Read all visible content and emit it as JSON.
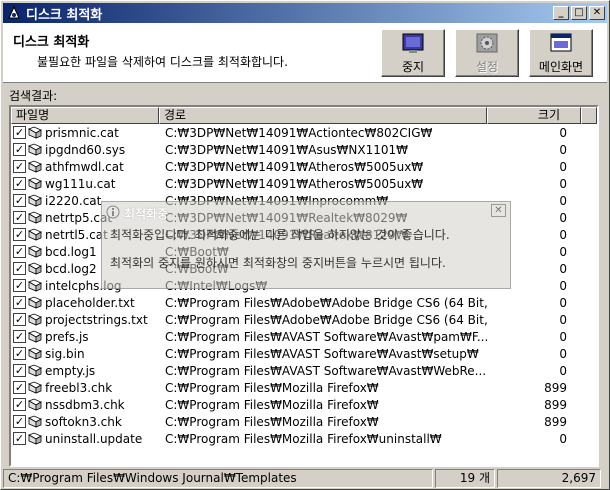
{
  "window": {
    "title": "디스크 최적화"
  },
  "header": {
    "title": "디스크 최적화",
    "description": "불필요한 파일을 삭제하여 디스크를 최적화합니다.",
    "buttons": {
      "stop": "중지",
      "settings": "설정",
      "main": "메인화면"
    }
  },
  "results": {
    "label": "검색결과:",
    "columns": {
      "name": "파일명",
      "path": "경로",
      "size": "크기"
    },
    "rows": [
      {
        "name": "prismnic.cat",
        "path": "C:₩3DP₩Net₩14091₩Actiontec₩802CIG₩",
        "size": "0"
      },
      {
        "name": "ipgdnd60.sys",
        "path": "C:₩3DP₩Net₩14091₩Asus₩NX1101₩",
        "size": "0"
      },
      {
        "name": "athfmwdl.cat",
        "path": "C:₩3DP₩Net₩14091₩Atheros₩5005ux₩",
        "size": "0"
      },
      {
        "name": "wg111u.cat",
        "path": "C:₩3DP₩Net₩14091₩Atheros₩5005ux₩",
        "size": "0"
      },
      {
        "name": "i2220.cat",
        "path": "C:₩3DP₩Net₩14091₩Inprocomm₩",
        "size": "0"
      },
      {
        "name": "netrtp5.cat",
        "path": "C:₩3DP₩Net₩14091₩Realtek₩8029₩",
        "size": "0"
      },
      {
        "name": "netrtl5.cat",
        "path": "C:₩3DP₩Net₩14091₩Realtek₩8129₩",
        "size": "0"
      },
      {
        "name": "bcd.log1",
        "path": "C:₩Boot₩",
        "size": "0"
      },
      {
        "name": "bcd.log2",
        "path": "C:₩Boot₩",
        "size": "0"
      },
      {
        "name": "intelcphs.log",
        "path": "C:₩Intel₩Logs₩",
        "size": "0"
      },
      {
        "name": "placeholder.txt",
        "path": "C:₩Program Files₩Adobe₩Adobe Bridge CS6 (64 Bit,...",
        "size": "0"
      },
      {
        "name": "projectstrings.txt",
        "path": "C:₩Program Files₩Adobe₩Adobe Bridge CS6 (64 Bit,...",
        "size": "0"
      },
      {
        "name": "prefs.js",
        "path": "C:₩Program Files₩AVAST Software₩Avast₩pam₩F...",
        "size": "0"
      },
      {
        "name": "sig.bin",
        "path": "C:₩Program Files₩AVAST Software₩Avast₩setup₩",
        "size": "0"
      },
      {
        "name": "empty.js",
        "path": "C:₩Program Files₩AVAST Software₩Avast₩WebRe...",
        "size": "0"
      },
      {
        "name": "freebl3.chk",
        "path": "C:₩Program Files₩Mozilla Firefox₩",
        "size": "899"
      },
      {
        "name": "nssdbm3.chk",
        "path": "C:₩Program Files₩Mozilla Firefox₩",
        "size": "899"
      },
      {
        "name": "softokn3.chk",
        "path": "C:₩Program Files₩Mozilla Firefox₩",
        "size": "899"
      },
      {
        "name": "uninstall.update",
        "path": "C:₩Program Files₩Mozilla Firefox₩uninstall₩",
        "size": "0"
      }
    ]
  },
  "toast": {
    "title": "최적화중",
    "line1": "최적화중입니다. 최적화중에는 다른 작업을 하지않는 것이 좋습니다.",
    "line2": "최적화의 중지를 원하시면 최적화창의 중지버튼을 누르시면 됩니다."
  },
  "status": {
    "path": "C:₩Program Files₩Windows Journal₩Templates",
    "count": "19 개",
    "total": "2,697"
  },
  "colors": {
    "titlebar_start": "#0a246a",
    "titlebar_end": "#a6caf0",
    "face": "#d4d0c8"
  },
  "icons": {
    "app": "disk-optimize-icon",
    "stop": "monitor-stop-icon",
    "settings": "gear-icon",
    "main": "window-home-icon"
  }
}
